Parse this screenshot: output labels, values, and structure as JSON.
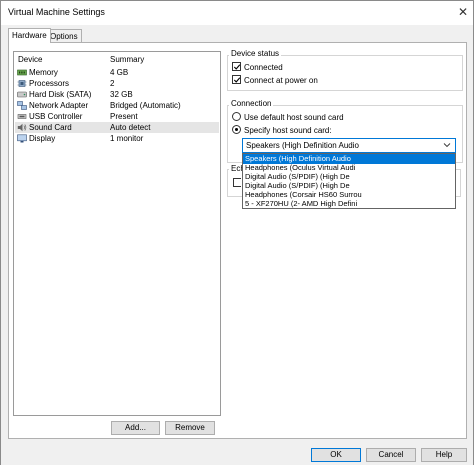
{
  "window": {
    "title": "Virtual Machine Settings",
    "close_glyph": "✕"
  },
  "tabs": [
    {
      "label": "Hardware",
      "active": true
    },
    {
      "label": "Options",
      "active": false
    }
  ],
  "device_list": {
    "columns": [
      "Device",
      "Summary"
    ],
    "rows": [
      {
        "device": "Memory",
        "summary": "4 GB",
        "icon": "memory-icon"
      },
      {
        "device": "Processors",
        "summary": "2",
        "icon": "processor-icon"
      },
      {
        "device": "Hard Disk (SATA)",
        "summary": "32 GB",
        "icon": "hard-disk-icon"
      },
      {
        "device": "Network Adapter",
        "summary": "Bridged (Automatic)",
        "icon": "network-adapter-icon"
      },
      {
        "device": "USB Controller",
        "summary": "Present",
        "icon": "usb-controller-icon"
      },
      {
        "device": "Sound Card",
        "summary": "Auto detect",
        "icon": "sound-card-icon",
        "selected": true
      },
      {
        "device": "Display",
        "summary": "1 monitor",
        "icon": "display-icon"
      }
    ],
    "add_button": "Add...",
    "remove_button": "Remove"
  },
  "device_status": {
    "title": "Device status",
    "connected": {
      "label": "Connected",
      "checked": true
    },
    "connect_at_power_on": {
      "label": "Connect at power on",
      "checked": true
    }
  },
  "connection": {
    "title": "Connection",
    "use_default": {
      "label": "Use default host sound card",
      "selected": false
    },
    "specify": {
      "label": "Specify host sound card:",
      "selected": true
    },
    "selected_value": "Speakers (High Definition Audio",
    "options": [
      "Speakers (High Definition Audio",
      "Headphones (Oculus Virtual Audi",
      "Digital Audio (S/PDIF) (High De",
      "Digital Audio (S/PDIF) (High De",
      "Headphones (Corsair HS60 Surrou",
      "5 - XF270HU (2- AMD High Defini"
    ],
    "highlighted_index": 0
  },
  "echo": {
    "title_partial": "Ech"
  },
  "footer": {
    "ok": "OK",
    "cancel": "Cancel",
    "help": "Help"
  },
  "colors": {
    "accent": "#0078d7",
    "window_bg": "#f0f0f0",
    "selection_bg": "#e5e5e5"
  }
}
